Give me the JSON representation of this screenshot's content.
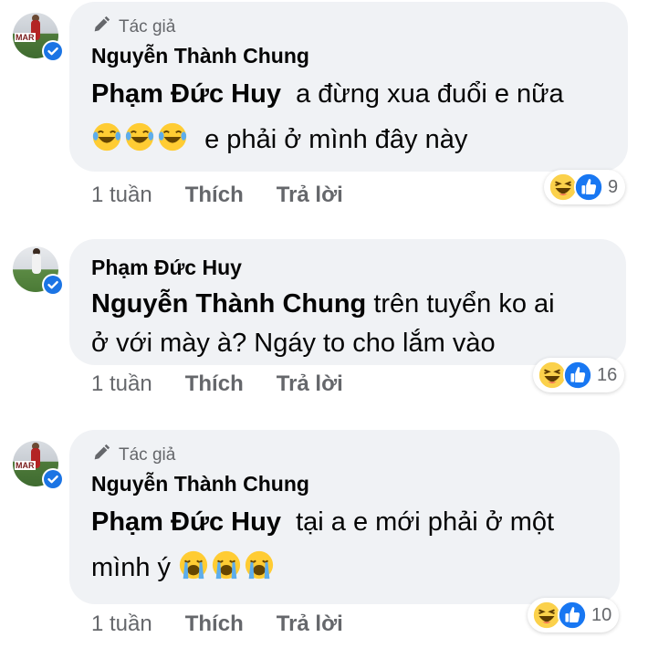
{
  "colors": {
    "bubble": "#f0f2f5",
    "meta": "#65676b",
    "like_blue": "#1877f2",
    "verified_blue": "#1b74e4"
  },
  "comments": [
    {
      "author_badge": "Tác giả",
      "author": "Nguyễn Thành Chung",
      "mention": "Phạm Đức Huy",
      "text_line1": "a đừng xua đuổi e nữa",
      "emoji": "laughing-emoji",
      "text_line2": "e phải ở mình đây này",
      "time": "1 tuần",
      "like_label": "Thích",
      "reply_label": "Trả lời",
      "reactions": [
        "haha-reaction-icon",
        "like-reaction-icon"
      ],
      "reaction_count": "9"
    },
    {
      "author": "Phạm Đức Huy",
      "mention": "Nguyễn Thành Chung",
      "text_line1": "trên tuyển ko ai",
      "text_line2": "ở với mày à? Ngáy to cho lắm vào",
      "time": "1 tuần",
      "like_label": "Thích",
      "reply_label": "Trả lời",
      "reactions": [
        "haha-reaction-icon",
        "like-reaction-icon"
      ],
      "reaction_count": "16"
    },
    {
      "author_badge": "Tác giả",
      "author": "Nguyễn Thành Chung",
      "mention": "Phạm Đức Huy",
      "text_line1": "tại a e mới phải ở một",
      "text_line2": "mình ý",
      "emoji": "crying-emoji",
      "time": "1 tuần",
      "like_label": "Thích",
      "reply_label": "Trả lời",
      "reactions": [
        "haha-reaction-icon",
        "like-reaction-icon"
      ],
      "reaction_count": "10"
    }
  ]
}
